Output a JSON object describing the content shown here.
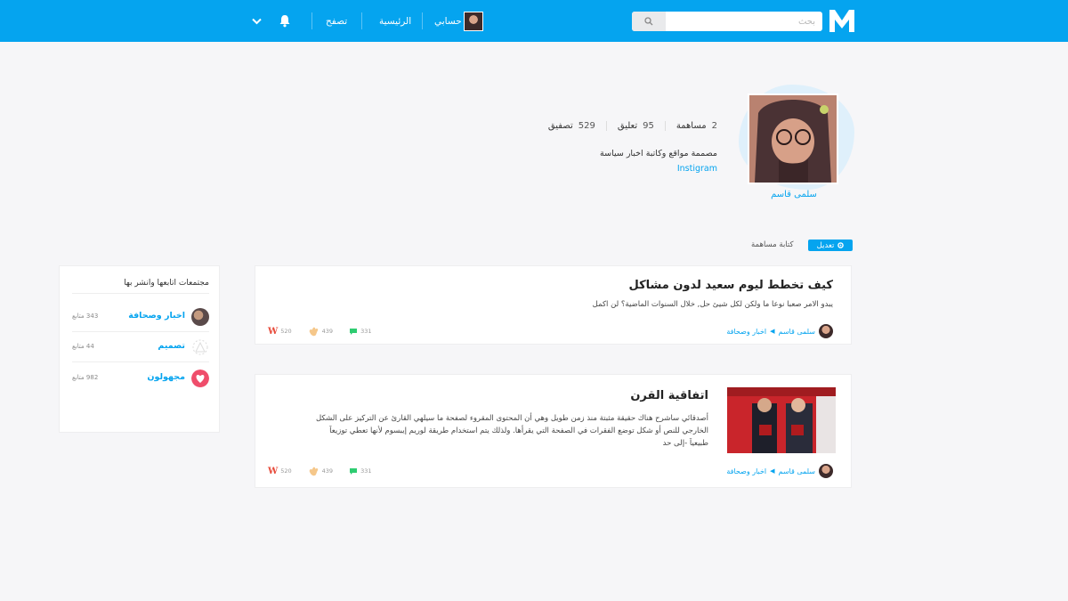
{
  "header": {
    "search_placeholder": "بحث",
    "nav": {
      "account_label": "حسابي",
      "home_label": "الرئيسية",
      "browse_label": "تصفح"
    }
  },
  "profile": {
    "name": "سلمى قاسم",
    "stats": [
      {
        "value": "2",
        "label": "مساهمة"
      },
      {
        "value": "95",
        "label": "تعليق"
      },
      {
        "value": "529",
        "label": "تصفيق"
      }
    ],
    "bio": "مصممة مواقع وكاتبة اخبار سياسة",
    "link": "Instigram",
    "edit_label": "تعديل",
    "write_label": "كتابة مساهمة"
  },
  "sidebar": {
    "title": "مجتمعات اتابعها وانشر بها",
    "communities": [
      {
        "name": "اخبار وصحافة",
        "count": "343 متابع",
        "icon": "news-photo"
      },
      {
        "name": "تصميم",
        "count": "44 متابع",
        "icon": "design-icon"
      },
      {
        "name": "مجهولون",
        "count": "982 متابع",
        "icon": "heart-icon"
      }
    ]
  },
  "posts": [
    {
      "title": "كيف تخطط ليوم سعيد لدون مشاكل",
      "excerpt": "يبدو الامر صعبا نوعا ما ولكن لكل شيئ حل, خلال السنوات الماضية؟ لن اكمل",
      "author": "سلمى قاسم",
      "community": "اخبار وصحافة",
      "likes": "331",
      "claps": "439",
      "w_count": "520"
    },
    {
      "title": "اتفاقية القرن",
      "excerpt": "أصدقائي ساشرح هناك حقيقة مثبتة منذ زمن طويل وهي أن المحتوى المقروء لصفحة ما سيلهي القارئ عن التركيز على الشكل الخارجي للنص أو شكل توضع الفقرات في الصفحة التي يقرأها. ولذلك يتم استخدام طريقة لوريم إيبسوم لأنها تعطي توزيعاَ طبيعياَ -إلى حد",
      "author": "سلمى قاسم",
      "community": "اخبار وصحافة",
      "likes": "331",
      "claps": "439",
      "w_count": "520"
    }
  ],
  "colors": {
    "brand": "#05a4ef",
    "background": "#f6f6f8",
    "like": "#2ecc71",
    "w": "#e74c3c"
  }
}
